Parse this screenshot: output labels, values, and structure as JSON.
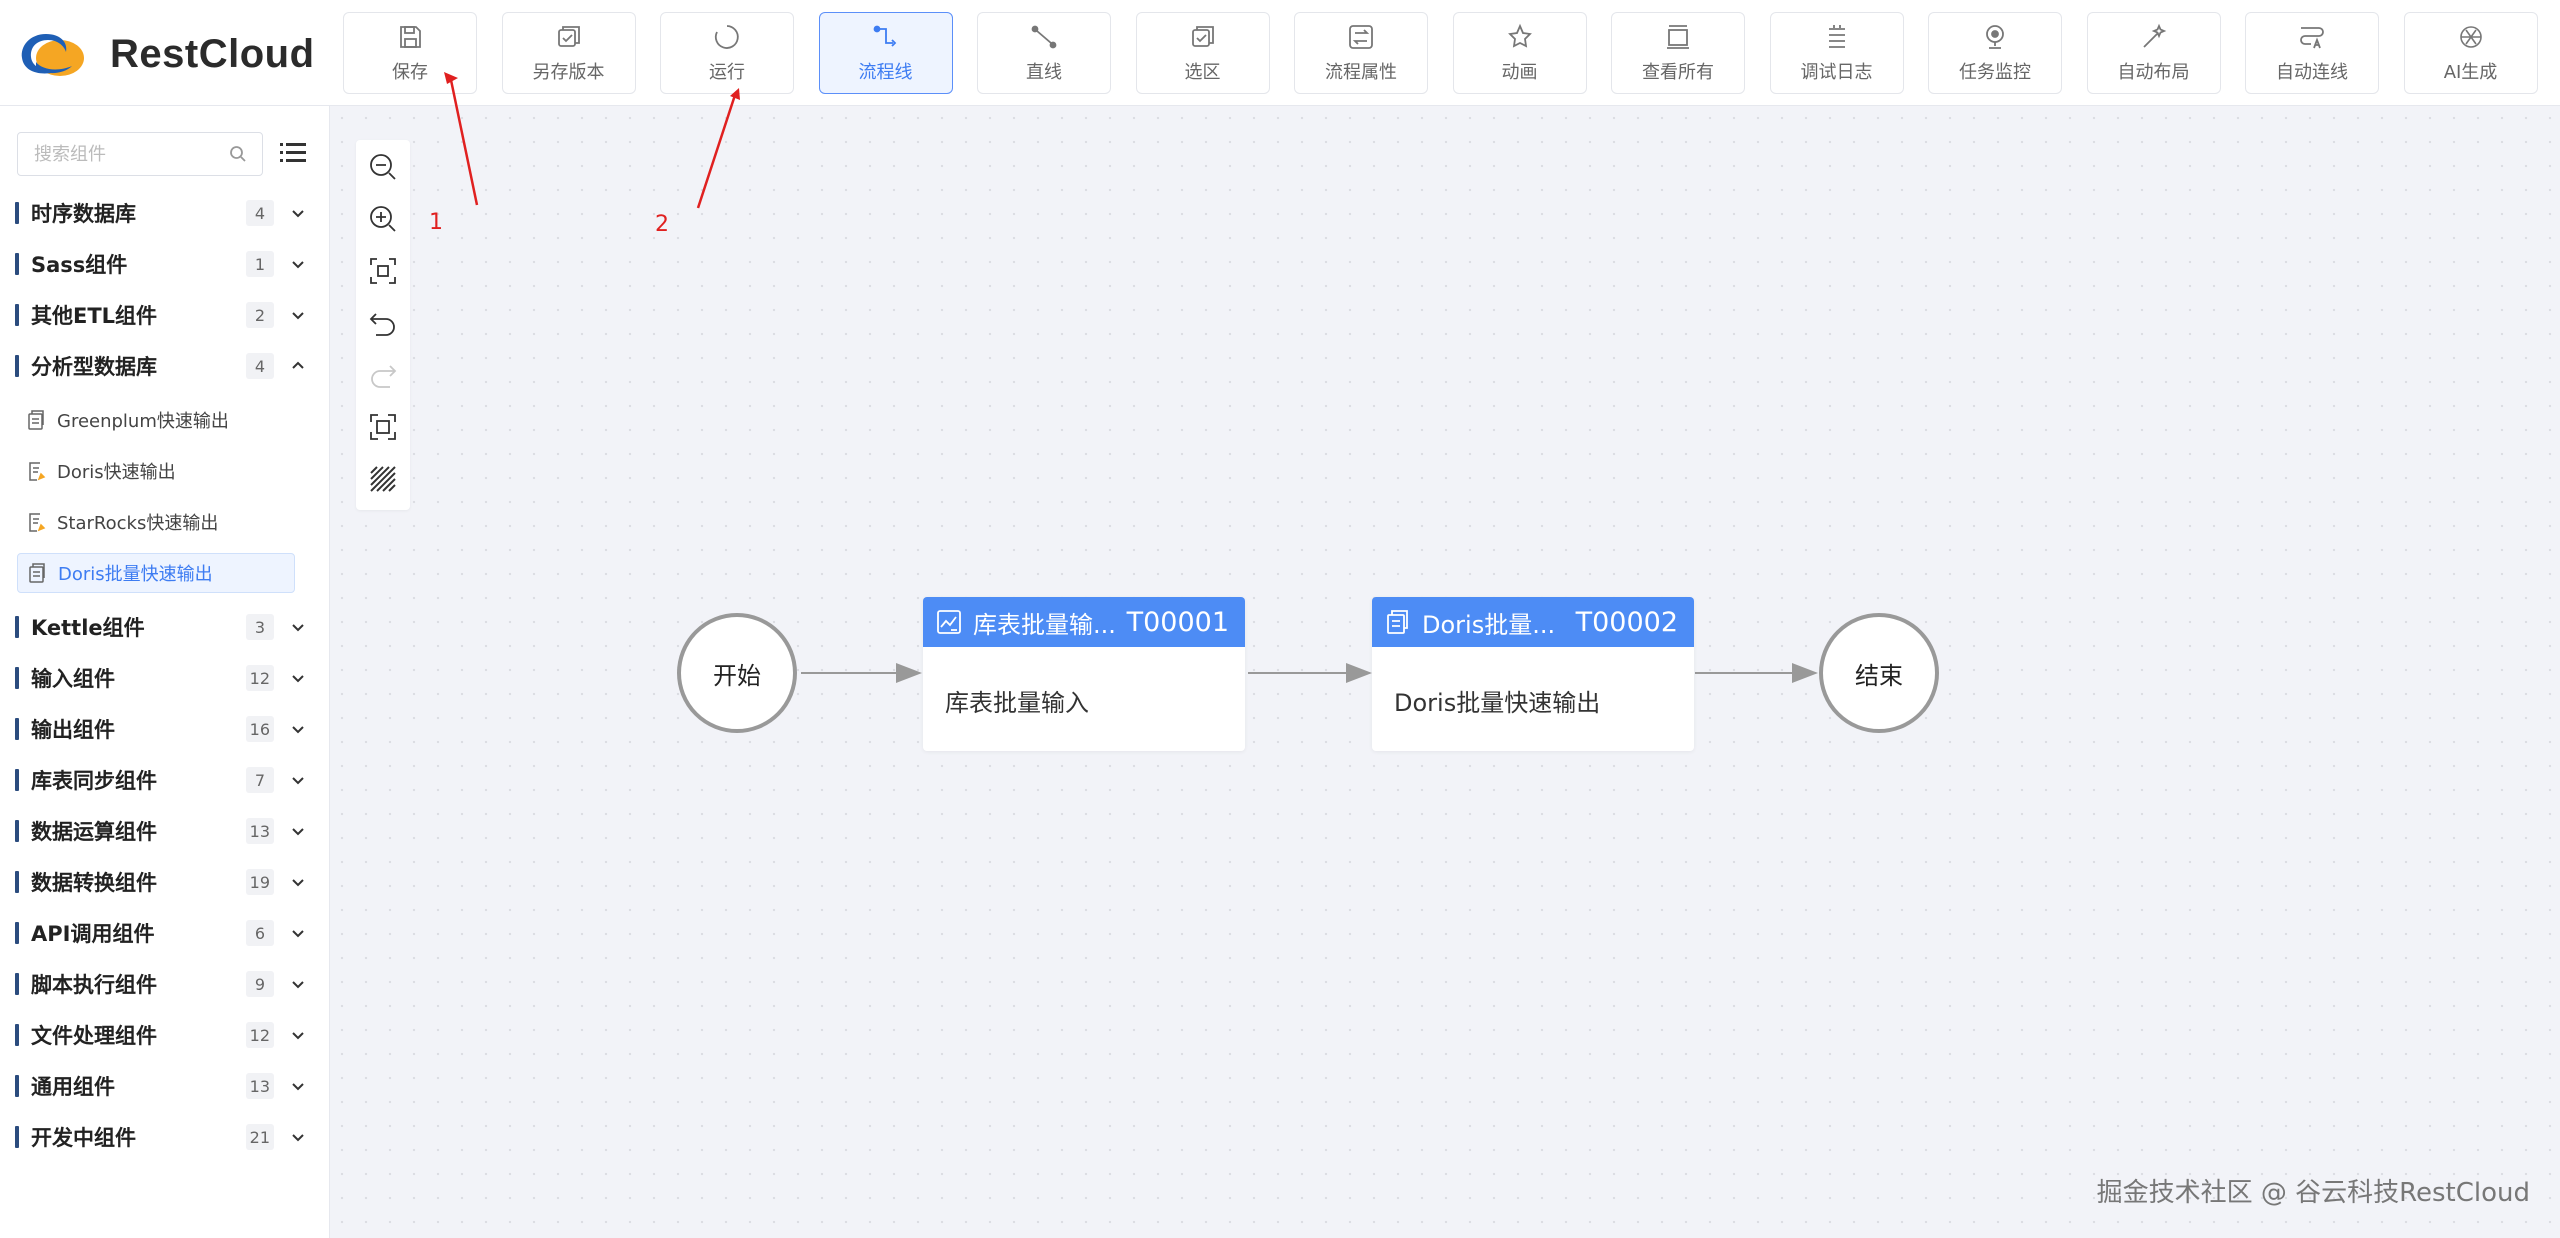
{
  "app": {
    "name": "RestCloud",
    "brand_color": "#1f5fb5",
    "accent": "#f5a623"
  },
  "toolbar": {
    "items": [
      {
        "label": "保存",
        "icon": "save-icon"
      },
      {
        "label": "另存版本",
        "icon": "save-version-icon"
      },
      {
        "label": "运行",
        "icon": "run-icon"
      },
      {
        "label": "流程线",
        "icon": "flow-line-icon",
        "active": true
      },
      {
        "label": "直线",
        "icon": "straight-line-icon"
      },
      {
        "label": "选区",
        "icon": "select-area-icon"
      },
      {
        "label": "流程属性",
        "icon": "flow-properties-icon"
      },
      {
        "label": "动画",
        "icon": "animation-icon"
      },
      {
        "label": "查看所有",
        "icon": "view-all-icon"
      },
      {
        "label": "调试日志",
        "icon": "debug-log-icon"
      },
      {
        "label": "任务监控",
        "icon": "task-monitor-icon"
      },
      {
        "label": "自动布局",
        "icon": "auto-layout-icon"
      },
      {
        "label": "自动连线",
        "icon": "auto-connect-icon"
      },
      {
        "label": "AI生成",
        "icon": "ai-generate-icon"
      }
    ]
  },
  "sidebar": {
    "search_placeholder": "搜索组件",
    "categories": [
      {
        "name": "时序数据库",
        "count": "4",
        "expanded": false
      },
      {
        "name": "Sass组件",
        "count": "1",
        "expanded": false
      },
      {
        "name": "其他ETL组件",
        "count": "2",
        "expanded": false
      },
      {
        "name": "分析型数据库",
        "count": "4",
        "expanded": true
      },
      {
        "name": "Kettle组件",
        "count": "3",
        "expanded": false
      },
      {
        "name": "输入组件",
        "count": "12",
        "expanded": false
      },
      {
        "name": "输出组件",
        "count": "16",
        "expanded": false
      },
      {
        "name": "库表同步组件",
        "count": "7",
        "expanded": false
      },
      {
        "name": "数据运算组件",
        "count": "13",
        "expanded": false
      },
      {
        "name": "数据转换组件",
        "count": "19",
        "expanded": false
      },
      {
        "name": "API调用组件",
        "count": "6",
        "expanded": false
      },
      {
        "name": "脚本执行组件",
        "count": "9",
        "expanded": false
      },
      {
        "name": "文件处理组件",
        "count": "12",
        "expanded": false
      },
      {
        "name": "通用组件",
        "count": "13",
        "expanded": false
      },
      {
        "name": "开发中组件",
        "count": "21",
        "expanded": false
      }
    ],
    "subitems": [
      {
        "name": "Greenplum快速输出"
      },
      {
        "name": "Doris快速输出"
      },
      {
        "name": "StarRocks快速输出"
      },
      {
        "name": "Doris批量快速输出",
        "selected": true
      }
    ]
  },
  "canvas": {
    "annotations": [
      "1",
      "2"
    ],
    "start_label": "开始",
    "end_label": "结束",
    "nodes": [
      {
        "title": "库表批量输...",
        "id": "T00001",
        "body": "库表批量输入"
      },
      {
        "title": "Doris批量...",
        "id": "T00002",
        "body": "Doris批量快速输出"
      }
    ]
  },
  "watermark": "掘金技术社区 @ 谷云科技RestCloud"
}
